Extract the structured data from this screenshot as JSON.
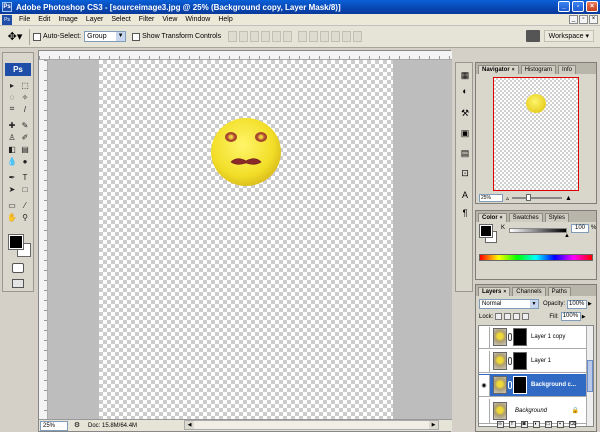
{
  "window": {
    "title": "Adobe Photoshop CS3 - [sourceimage3.jpg @ 25% (Background copy, Layer Mask/8)]",
    "ps_icon": "Ps"
  },
  "menu": {
    "items": [
      "File",
      "Edit",
      "Image",
      "Layer",
      "Select",
      "Filter",
      "View",
      "Window",
      "Help"
    ]
  },
  "options": {
    "auto_select_label": "Auto-Select:",
    "auto_select_value": "Group",
    "show_transform_label": "Show Transform Controls",
    "workspace_label": "Workspace ▾"
  },
  "tools": {
    "logo": "Ps"
  },
  "document": {
    "zoom": "25%",
    "doc_size": "Doc: 15.8M/64.4M"
  },
  "navigator": {
    "tabs": [
      "Navigator",
      "Histogram",
      "Info"
    ],
    "zoom": "25%"
  },
  "color": {
    "tabs": [
      "Color",
      "Swatches",
      "Styles"
    ],
    "k_label": "K",
    "k_value": "100",
    "k_unit": "%"
  },
  "layers": {
    "tabs": [
      "Layers",
      "Channels",
      "Paths"
    ],
    "blend_mode": "Normal",
    "opacity_label": "Opacity:",
    "opacity_value": "100%",
    "lock_label": "Lock:",
    "fill_label": "Fill:",
    "fill_value": "100%",
    "items": [
      {
        "name": "Layer 1 copy"
      },
      {
        "name": "Layer 1"
      },
      {
        "name": "Background c..."
      },
      {
        "name": "Background"
      }
    ]
  },
  "colors": {
    "title_bar": "#0846b2",
    "selection": "#316ac5",
    "navigator_frame": "#dd0000"
  }
}
